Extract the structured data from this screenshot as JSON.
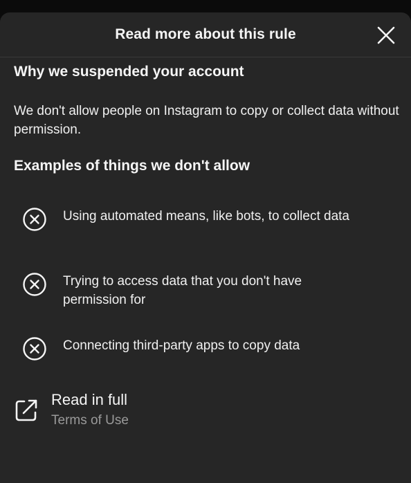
{
  "dialog": {
    "title": "Read more about this rule",
    "close_icon": "close-icon"
  },
  "section1": {
    "heading": "Why we suspended your account",
    "description": "We don't allow people on Instagram to copy or collect data without permission."
  },
  "section2": {
    "heading": "Examples of things we don't allow",
    "examples": [
      {
        "icon": "circle-x-icon",
        "label": "Using automated means, like bots, to collect data"
      },
      {
        "icon": "circle-x-icon",
        "label": "Trying to access data that you don't have permission for"
      },
      {
        "icon": "circle-x-icon",
        "label": "Connecting third-party apps to copy data"
      }
    ]
  },
  "read_full": {
    "icon": "external-link-icon",
    "title": "Read in full",
    "subtitle": "Terms of Use"
  }
}
